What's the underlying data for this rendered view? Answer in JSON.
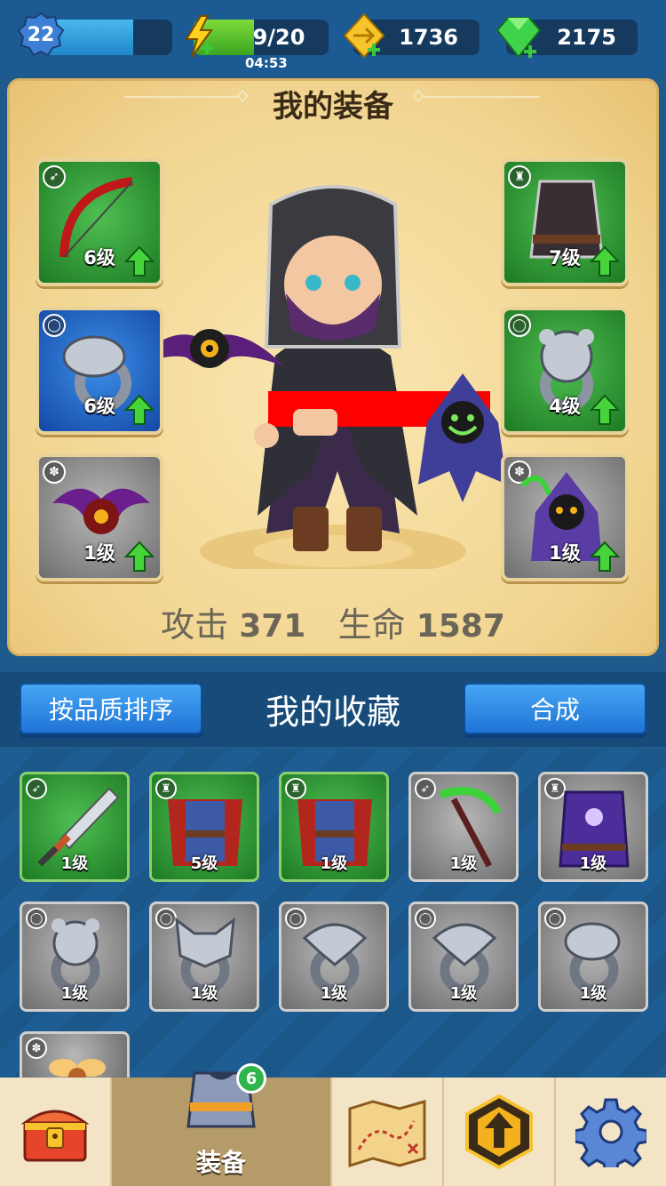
{
  "top_bar": {
    "level": "22",
    "xp_progress": 0.7,
    "energy": "9/20",
    "energy_progress": 0.45,
    "energy_timer": "04:53",
    "gold": "1736",
    "gems": "2175"
  },
  "equipment": {
    "title": "我的装备",
    "slots": [
      {
        "side": "left",
        "type": "weapon",
        "level": "6级",
        "rarity": "green",
        "upgrade": true,
        "art": "red-bow-icon"
      },
      {
        "side": "left",
        "type": "ring",
        "level": "6级",
        "rarity": "blue",
        "upgrade": true,
        "art": "snake-ring-icon"
      },
      {
        "side": "left",
        "type": "pet",
        "level": "1级",
        "rarity": "grey",
        "upgrade": true,
        "art": "bat-eye-pet-icon"
      },
      {
        "side": "right",
        "type": "armor",
        "level": "7级",
        "rarity": "green",
        "upgrade": true,
        "art": "dark-vest-icon"
      },
      {
        "side": "right",
        "type": "ring",
        "level": "4级",
        "rarity": "green",
        "upgrade": true,
        "art": "bear-ring-icon"
      },
      {
        "side": "right",
        "type": "pet",
        "level": "1级",
        "rarity": "grey",
        "upgrade": true,
        "art": "reaper-pet-icon"
      }
    ],
    "attack_label": "攻击",
    "attack_value": "371",
    "hp_label": "生命",
    "hp_value": "1587"
  },
  "collection": {
    "sort_button": "按品质排序",
    "title": "我的收藏",
    "merge_button": "合成",
    "items": [
      {
        "type": "weapon",
        "level": "1级",
        "rarity": "green",
        "art": "sword-icon"
      },
      {
        "type": "armor",
        "level": "5级",
        "rarity": "green",
        "art": "red-cape-armor-icon"
      },
      {
        "type": "armor",
        "level": "1级",
        "rarity": "green",
        "art": "red-cape-armor-icon"
      },
      {
        "type": "weapon",
        "level": "1级",
        "rarity": "grey",
        "art": "scythe-icon"
      },
      {
        "type": "armor",
        "level": "1级",
        "rarity": "grey",
        "art": "purple-robe-icon"
      },
      {
        "type": "ring",
        "level": "1级",
        "rarity": "grey",
        "art": "bear-ring-icon"
      },
      {
        "type": "ring",
        "level": "1级",
        "rarity": "grey",
        "art": "wolf-ring-icon"
      },
      {
        "type": "ring",
        "level": "1级",
        "rarity": "grey",
        "art": "eagle-ring-icon"
      },
      {
        "type": "ring",
        "level": "1级",
        "rarity": "grey",
        "art": "eagle-ring-icon"
      },
      {
        "type": "ring",
        "level": "1级",
        "rarity": "grey",
        "art": "snake-ring-icon"
      },
      {
        "type": "pet",
        "level": "",
        "rarity": "grey",
        "art": "fairy-pet-icon"
      }
    ]
  },
  "bottom_nav": {
    "items": [
      {
        "name": "chest",
        "icon": "treasure-chest-icon",
        "label": ""
      },
      {
        "name": "equipment",
        "icon": "armor-icon",
        "label": "装备",
        "badge": "6",
        "active": true
      },
      {
        "name": "map",
        "icon": "treasure-map-icon",
        "label": ""
      },
      {
        "name": "upgrade",
        "icon": "upgrade-arrow-icon",
        "label": ""
      },
      {
        "name": "settings",
        "icon": "gear-icon",
        "label": ""
      }
    ]
  },
  "colors": {
    "green_rarity": "#2e9a35",
    "blue_rarity": "#1e63c6",
    "grey_rarity": "#8a8a8a",
    "button_blue": "#2f86e4",
    "panel_cream": "#f3d996"
  }
}
